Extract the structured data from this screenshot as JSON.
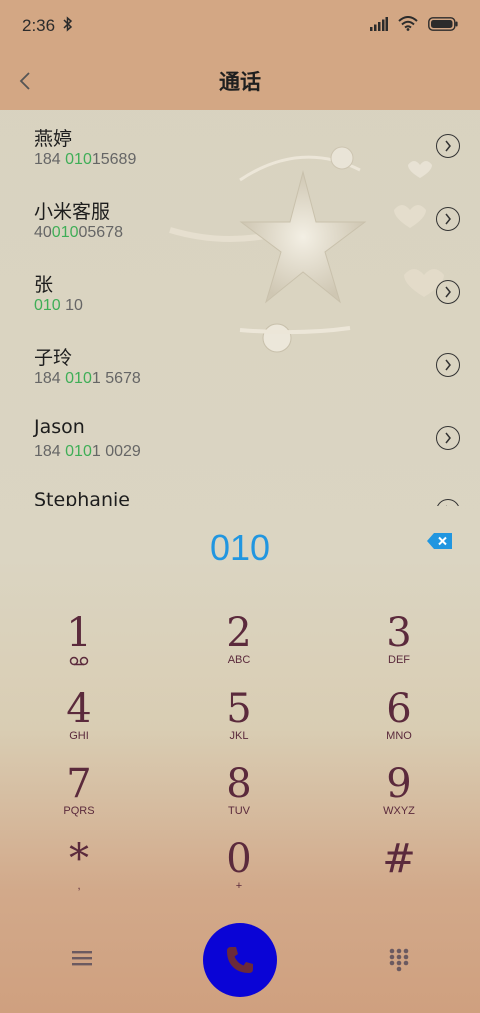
{
  "status_bar": {
    "time": "2:36"
  },
  "header": {
    "title": "通话"
  },
  "contacts": [
    {
      "name": "燕婷",
      "number_pre": "184 ",
      "number_hl": "010",
      "number_post": "15689"
    },
    {
      "name": "小米客服",
      "number_pre": "40",
      "number_hl": "010",
      "number_post": "05678"
    },
    {
      "name": "张",
      "number_pre": "",
      "number_hl": "010",
      "number_post": " 10"
    },
    {
      "name": "子玲",
      "number_pre": "184 ",
      "number_hl": "010",
      "number_post": "1 5678"
    },
    {
      "name": "Jason",
      "number_pre": "184 ",
      "number_hl": "010",
      "number_post": "1 0029"
    },
    {
      "name": "Stephanie",
      "number_pre": "",
      "number_hl": "",
      "number_post": ""
    }
  ],
  "dialer": {
    "input": "010"
  },
  "keypad": [
    {
      "digit": "1",
      "letters": ""
    },
    {
      "digit": "2",
      "letters": "ABC"
    },
    {
      "digit": "3",
      "letters": "DEF"
    },
    {
      "digit": "4",
      "letters": "GHI"
    },
    {
      "digit": "5",
      "letters": "JKL"
    },
    {
      "digit": "6",
      "letters": "MNO"
    },
    {
      "digit": "7",
      "letters": "PQRS"
    },
    {
      "digit": "8",
      "letters": "TUV"
    },
    {
      "digit": "9",
      "letters": "WXYZ"
    },
    {
      "digit": "*",
      "letters": ","
    },
    {
      "digit": "0",
      "letters": "+"
    },
    {
      "digit": "#",
      "letters": ""
    }
  ],
  "colors": {
    "accent": "#2196e0",
    "highlight": "#3fae57",
    "key_text": "#5b2a3c",
    "call_button": "#0a04d6",
    "header_bg": "#d3a784"
  }
}
